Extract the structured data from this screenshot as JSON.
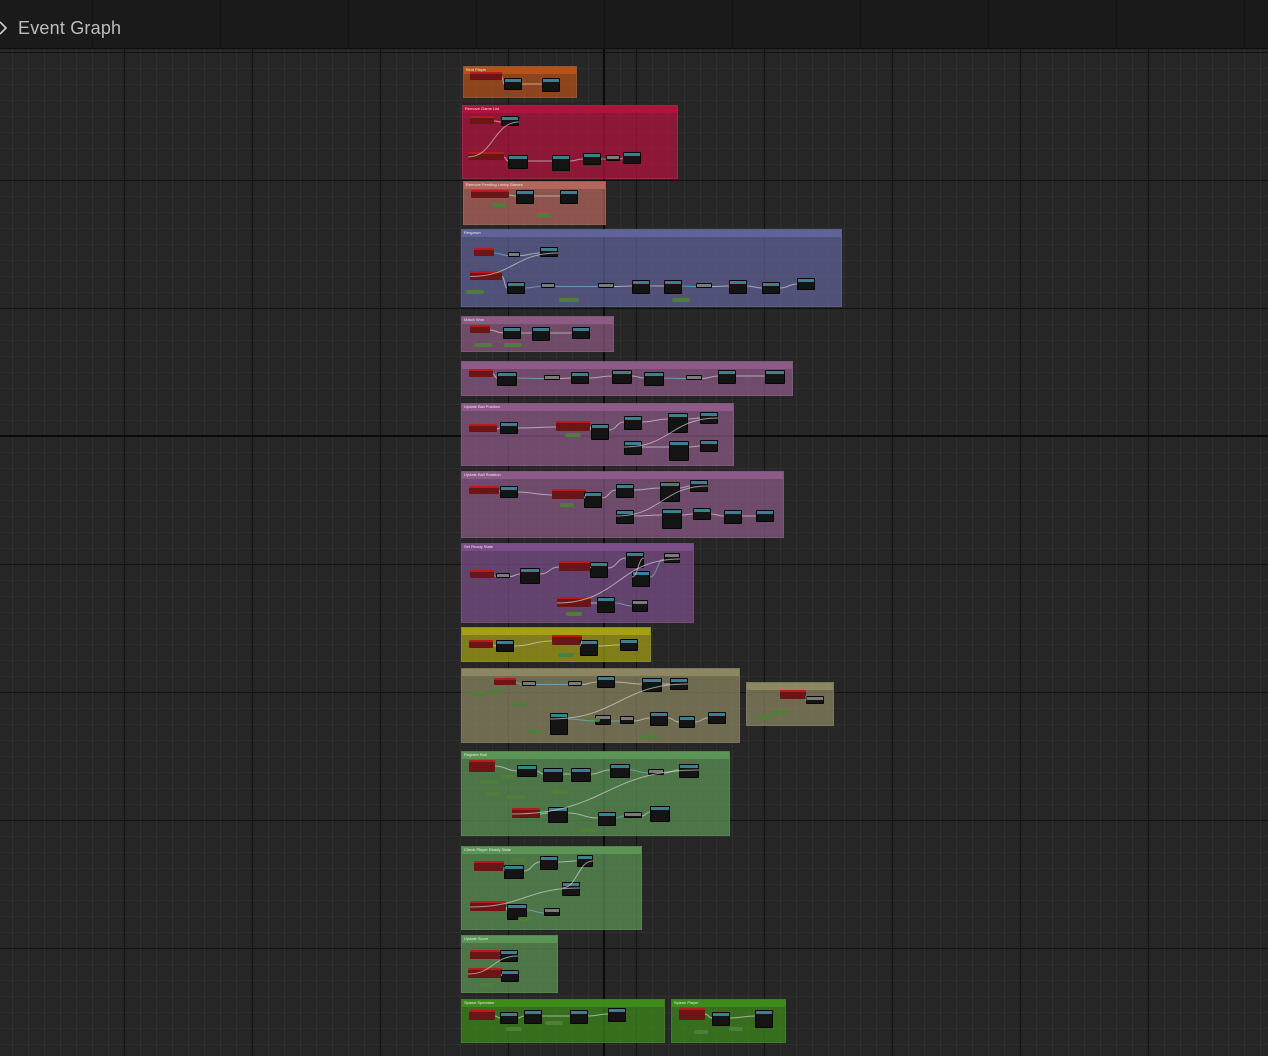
{
  "graph": {
    "title": "Event Graph"
  },
  "comments": [
    {
      "label": "Bind Player",
      "color": "#b5521a"
    },
    {
      "label": "Remove Game List",
      "color": "#b4123e"
    },
    {
      "label": "Remove Pending Lobby Games",
      "color": "#b4665c"
    },
    {
      "label": "Respawn",
      "color": "#5f6399"
    },
    {
      "label": "Match Won",
      "color": "#8c5a82"
    },
    {
      "label": "",
      "color": "#8e5a88"
    },
    {
      "label": "Update Ball Position",
      "color": "#8e5a88"
    },
    {
      "label": "Update Ball Rotation",
      "color": "#8c5a86"
    },
    {
      "label": "Set Ready State",
      "color": "#7d4d8a"
    },
    {
      "label": "",
      "color": "#a5a018"
    },
    {
      "label": "",
      "color": "#8c8662"
    },
    {
      "label": "",
      "color": "#8c8662"
    },
    {
      "label": "Register Ball",
      "color": "#5b9556"
    },
    {
      "label": "Check Player Ready State",
      "color": "#5b9556"
    },
    {
      "label": "Update Score",
      "color": "#5b9556"
    },
    {
      "label": "Spawn Spectator",
      "color": "#3e8b1c"
    },
    {
      "label": "Spawn Player",
      "color": "#3e8b1c"
    }
  ],
  "colors": {
    "grid_background": "#262626",
    "event_node": "#b81b1b",
    "function_node": "#3d7f8f",
    "pure_node": "#7b7b7b",
    "variable_pin": "#4f7d3a",
    "exec_wire": "#cfcfcf",
    "data_wire": "#6fb7c8"
  }
}
